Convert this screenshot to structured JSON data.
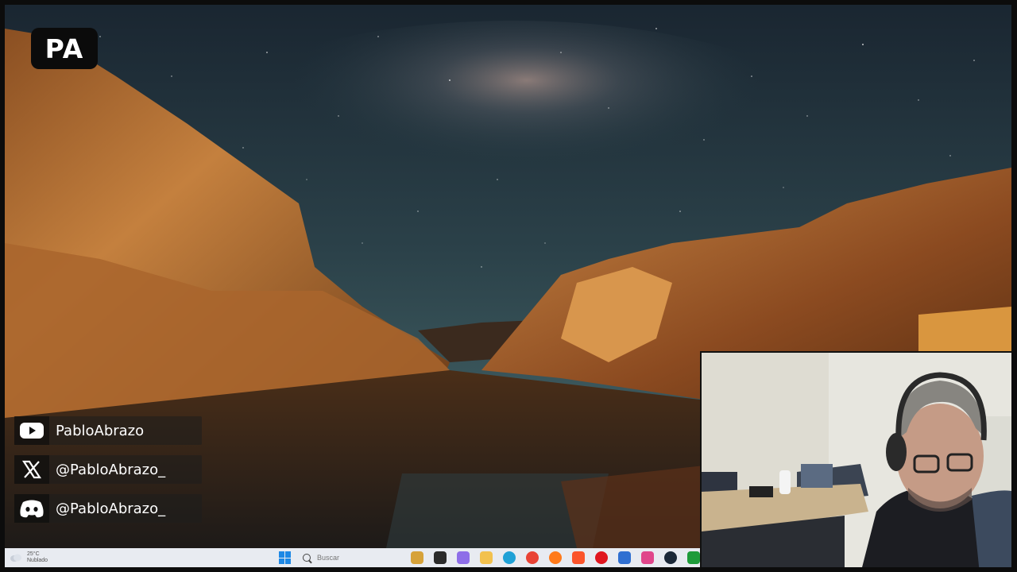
{
  "overlay": {
    "logo_text": "PA",
    "socials": [
      {
        "icon": "youtube-icon",
        "handle": "PabloAbrazo"
      },
      {
        "icon": "x-icon",
        "handle": "@PabloAbrazo_"
      },
      {
        "icon": "discord-icon",
        "handle": "@PabloAbrazo_"
      }
    ]
  },
  "taskbar": {
    "weather_temp": "25°C",
    "weather_desc": "Nublado",
    "search_placeholder": "Buscar",
    "apps": [
      {
        "name": "file-manager",
        "color": "#d6a23a"
      },
      {
        "name": "terminal",
        "color": "#2b2b2b"
      },
      {
        "name": "copilot",
        "color": "#8e6ee8"
      },
      {
        "name": "file-explorer",
        "color": "#f2c14e"
      },
      {
        "name": "edge",
        "color": "#1fa1d6"
      },
      {
        "name": "chrome",
        "color": "#e94335"
      },
      {
        "name": "firefox",
        "color": "#ff7a1a"
      },
      {
        "name": "brave",
        "color": "#fb542b"
      },
      {
        "name": "opera",
        "color": "#e0161f"
      },
      {
        "name": "mail",
        "color": "#2f6fd1"
      },
      {
        "name": "snipping-tool",
        "color": "#e0468b"
      },
      {
        "name": "steam",
        "color": "#1b2838"
      },
      {
        "name": "xbox",
        "color": "#1e9b3a"
      }
    ]
  },
  "colors": {
    "sky_top": "#1b2a33",
    "sky_mid": "#2e4a52",
    "rock": "#b06b2c",
    "taskbar": "#e8ebf1"
  }
}
